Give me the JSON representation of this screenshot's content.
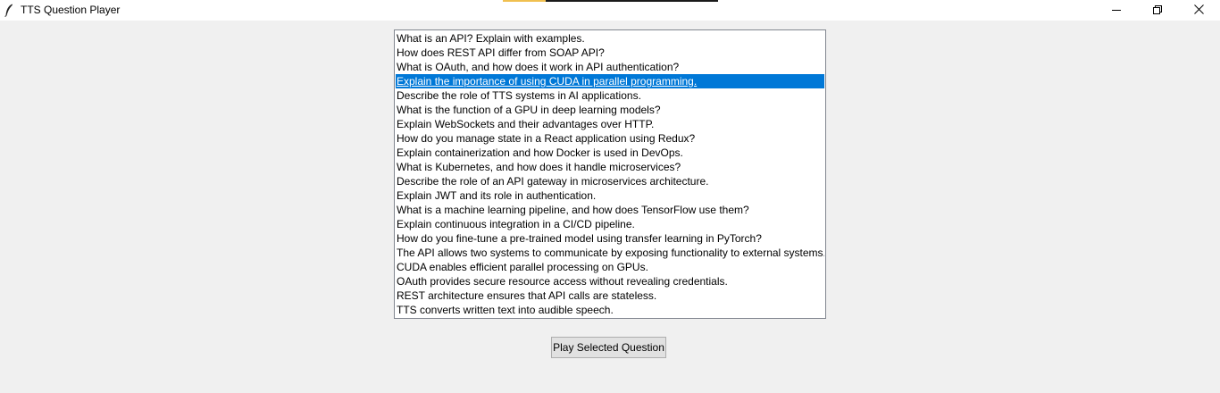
{
  "window": {
    "title": "TTS Question Player",
    "controls": {
      "minimize_icon": "minimize-icon",
      "maximize_icon": "restore-icon",
      "close_icon": "close-icon"
    },
    "title_icon": "feather-icon"
  },
  "questions": {
    "selected_index": 3,
    "selected_color": "#0078d7",
    "items": [
      "What is an API? Explain with examples.",
      "How does REST API differ from SOAP API?",
      "What is OAuth, and how does it work in API authentication?",
      "Explain the importance of using CUDA in parallel programming.",
      "Describe the role of TTS systems in AI applications.",
      "What is the function of a GPU in deep learning models?",
      "Explain WebSockets and their advantages over HTTP.",
      "How do you manage state in a React application using Redux?",
      "Explain containerization and how Docker is used in DevOps.",
      "What is Kubernetes, and how does it handle microservices?",
      "Describe the role of an API gateway in microservices architecture.",
      "Explain JWT and its role in authentication.",
      "What is a machine learning pipeline, and how does TensorFlow use them?",
      "Explain continuous integration in a CI/CD pipeline.",
      "How do you fine-tune a pre-trained model using transfer learning in PyTorch?",
      "The API allows two systems to communicate by exposing functionality to external systems.",
      "CUDA enables efficient parallel processing on GPUs.",
      "OAuth provides secure resource access without revealing credentials.",
      "REST architecture ensures that API calls are stateless.",
      "TTS converts written text into audible speech."
    ]
  },
  "actions": {
    "play_label": "Play Selected Question"
  }
}
